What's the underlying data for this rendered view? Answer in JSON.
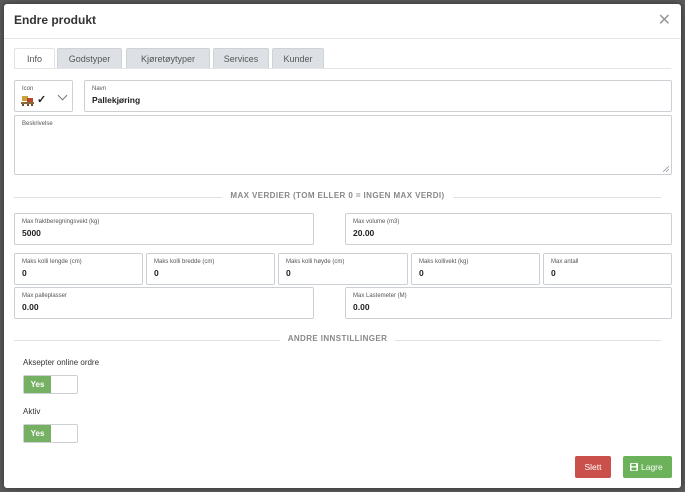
{
  "dialog": {
    "title": "Endre produkt"
  },
  "tabs": [
    {
      "label": "Info",
      "active": true
    },
    {
      "label": "Godstyper",
      "active": false
    },
    {
      "label": "Kjøretøytyper",
      "active": false
    },
    {
      "label": "Services",
      "active": false
    },
    {
      "label": "Kunder",
      "active": false
    }
  ],
  "icon_field": {
    "label": "Icon",
    "icon": "pallet-check-icon",
    "check": "✓"
  },
  "name_field": {
    "label": "Navn",
    "value": "Pallekjøring"
  },
  "description_field": {
    "label": "Beskrivelse",
    "value": ""
  },
  "max_section": {
    "heading": "MAX VERDIER (TOM ELLER 0 = INGEN MAX VERDI)"
  },
  "max_fields": {
    "freight_weight": {
      "label": "Max fraktberegningsvekt (kg)",
      "value": "5000"
    },
    "volume": {
      "label": "Max volume (m3)",
      "value": "20.00"
    },
    "length": {
      "label": "Maks kolli lengde (cm)",
      "value": "0"
    },
    "width": {
      "label": "Maks kolli bredde (cm)",
      "value": "0"
    },
    "height": {
      "label": "Maks kolli høyde (cm)",
      "value": "0"
    },
    "kolli_weight": {
      "label": "Maks kollivekt (kg)",
      "value": "0"
    },
    "max_count": {
      "label": "Max antall",
      "value": "0"
    },
    "pallet_places": {
      "label": "Max palleplasser",
      "value": "0.00"
    },
    "loading_meter": {
      "label": "Max Lastemeter (M)",
      "value": "0.00"
    }
  },
  "other_section": {
    "heading": "ANDRE INNSTILLINGER"
  },
  "settings": {
    "online_orders": {
      "label": "Aksepter online ordre",
      "toggle": "Yes",
      "on": true
    },
    "active": {
      "label": "Aktiv",
      "toggle": "Yes",
      "on": true
    }
  },
  "buttons": {
    "delete": "Slett",
    "save": "Lagre"
  },
  "colors": {
    "primary_green": "#76b063",
    "danger_red": "#c9504b",
    "save_green": "#6cb25a"
  }
}
